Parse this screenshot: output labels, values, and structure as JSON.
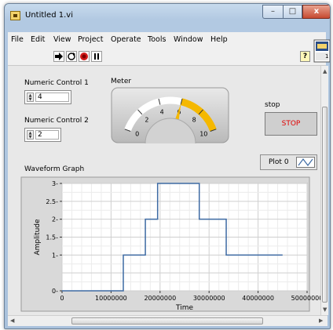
{
  "window": {
    "title": "Untitled 1.vi",
    "buttons": {
      "minimize": "–",
      "maximize": "□",
      "close": "x"
    }
  },
  "menu": [
    "File",
    "Edit",
    "View",
    "Project",
    "Operate",
    "Tools",
    "Window",
    "Help"
  ],
  "toolbar": {
    "buttons": [
      {
        "name": "run",
        "icon": "run-arrow-icon"
      },
      {
        "name": "run-continuously",
        "icon": "run-continuously-icon"
      },
      {
        "name": "abort",
        "icon": "abort-stop-icon"
      },
      {
        "name": "pause",
        "icon": "pause-icon"
      }
    ],
    "help": "?",
    "vi_icon_label": "1"
  },
  "controls": {
    "numeric1": {
      "label": "Numeric Control 1",
      "value": "4"
    },
    "numeric2": {
      "label": "Numeric Control 2",
      "value": "2"
    }
  },
  "meter": {
    "label": "Meter",
    "min": 0,
    "max": 10,
    "ticks": [
      "0",
      "2",
      "4",
      "6",
      "8",
      "10"
    ],
    "value": 6,
    "accent": "#f5b800"
  },
  "stop": {
    "label": "stop",
    "button_text": "STOP",
    "color": "#e10000"
  },
  "plot_legend": {
    "label": "Plot 0"
  },
  "graph": {
    "label": "Waveform Graph"
  },
  "chart_data": {
    "type": "line",
    "ylabel": "Amplitude",
    "xlabel": "Time",
    "xlim": [
      0,
      50000000
    ],
    "ylim": [
      0,
      3
    ],
    "x_ticks": [
      "0",
      "10000000",
      "20000000",
      "30000000",
      "40000000",
      "50000000"
    ],
    "y_ticks": [
      "0",
      "1",
      "1.5",
      "2",
      "2.5",
      "3"
    ],
    "y_tick_values": [
      0,
      1,
      1.5,
      2,
      2.5,
      3
    ],
    "grid": true,
    "series": [
      {
        "color": "#3d6aa3",
        "x": [
          0,
          12500000,
          12500000,
          17000000,
          17000000,
          19500000,
          19500000,
          28000000,
          28000000,
          33500000,
          33500000,
          45000000
        ],
        "y": [
          0,
          0,
          1,
          1,
          2,
          2,
          3,
          3,
          2,
          2,
          1,
          1
        ]
      }
    ]
  }
}
